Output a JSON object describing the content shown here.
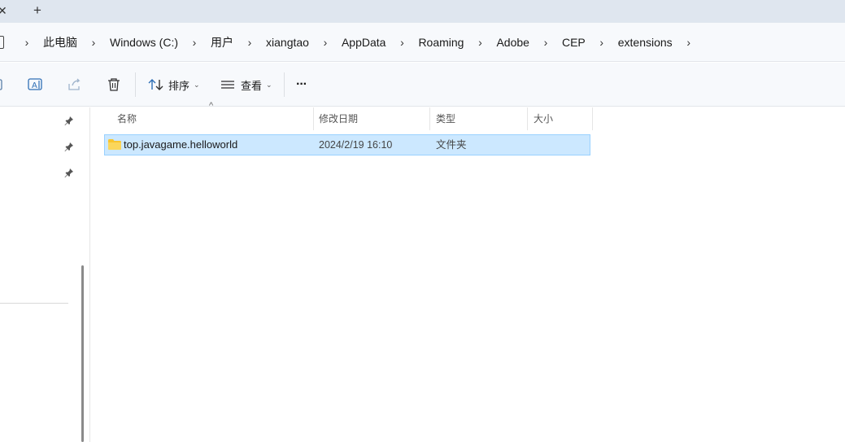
{
  "tabs": {
    "close_glyph": "✕",
    "new_tab_glyph": "+"
  },
  "breadcrumb": {
    "items": [
      "此电脑",
      "Windows (C:)",
      "用户",
      "xiangtao",
      "AppData",
      "Roaming",
      "Adobe",
      "CEP",
      "extensions"
    ],
    "separator": "›"
  },
  "toolbar": {
    "sort_label": "排序",
    "view_label": "查看",
    "more_label": "···"
  },
  "columns": {
    "name": "名称",
    "modified": "修改日期",
    "type": "类型",
    "size": "大小"
  },
  "files": [
    {
      "name": "top.javagame.helloworld",
      "modified": "2024/2/19 16:10",
      "type": "文件夹",
      "size": "",
      "selected": true
    }
  ],
  "colors": {
    "selection": "#cce8ff",
    "selection_border": "#99d1ff",
    "folder": "#f8c52f"
  }
}
